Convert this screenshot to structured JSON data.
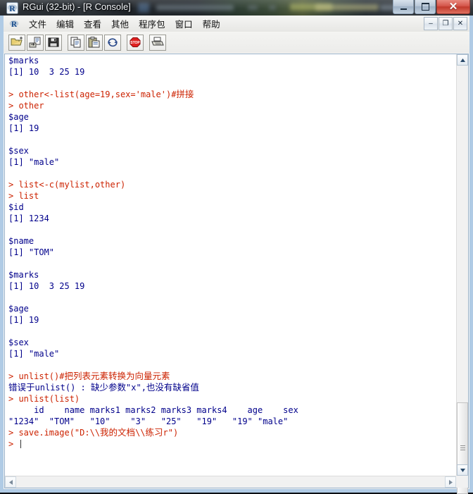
{
  "window": {
    "title": "RGui (32-bit) - [R Console]",
    "icon": "r-logo-icon",
    "caption_buttons": [
      {
        "name": "minimize-button",
        "label": "–"
      },
      {
        "name": "maximize-button",
        "label": "□"
      },
      {
        "name": "close-button",
        "label": "✕"
      }
    ]
  },
  "menubar": {
    "icon": "r-logo-icon",
    "items": [
      {
        "label": "文件"
      },
      {
        "label": "编辑"
      },
      {
        "label": "查看"
      },
      {
        "label": "其他"
      },
      {
        "label": "程序包"
      },
      {
        "label": "窗口"
      },
      {
        "label": "帮助"
      }
    ],
    "mdi_buttons": [
      {
        "name": "mdi-minimize-button",
        "label": "–"
      },
      {
        "name": "mdi-restore-button",
        "label": "❐"
      },
      {
        "name": "mdi-close-button",
        "label": "✕"
      }
    ]
  },
  "toolbar": {
    "buttons": [
      {
        "name": "open-script-icon",
        "tip": "Open script"
      },
      {
        "name": "load-workspace-icon",
        "tip": "Load workspace"
      },
      {
        "name": "save-workspace-icon",
        "tip": "Save workspace"
      },
      {
        "name": "copy-icon",
        "tip": "Copy"
      },
      {
        "name": "paste-icon",
        "tip": "Paste"
      },
      {
        "name": "copy-paste-icon",
        "tip": "Copy and paste"
      },
      {
        "name": "stop-icon",
        "tip": "Stop current computation"
      },
      {
        "name": "print-icon",
        "tip": "Print"
      }
    ]
  },
  "console": {
    "lines": [
      {
        "type": "out",
        "text": "$marks"
      },
      {
        "type": "out",
        "text": "[1] 10  3 25 19"
      },
      {
        "type": "blank",
        "text": ""
      },
      {
        "type": "cmd",
        "text": "> other<-list(age=19,sex='male')#拼接"
      },
      {
        "type": "cmd",
        "text": "> other"
      },
      {
        "type": "out",
        "text": "$age"
      },
      {
        "type": "out",
        "text": "[1] 19"
      },
      {
        "type": "blank",
        "text": ""
      },
      {
        "type": "out",
        "text": "$sex"
      },
      {
        "type": "out",
        "text": "[1] \"male\""
      },
      {
        "type": "blank",
        "text": ""
      },
      {
        "type": "cmd",
        "text": "> list<-c(mylist,other)"
      },
      {
        "type": "cmd",
        "text": "> list"
      },
      {
        "type": "out",
        "text": "$id"
      },
      {
        "type": "out",
        "text": "[1] 1234"
      },
      {
        "type": "blank",
        "text": ""
      },
      {
        "type": "out",
        "text": "$name"
      },
      {
        "type": "out",
        "text": "[1] \"TOM\""
      },
      {
        "type": "blank",
        "text": ""
      },
      {
        "type": "out",
        "text": "$marks"
      },
      {
        "type": "out",
        "text": "[1] 10  3 25 19"
      },
      {
        "type": "blank",
        "text": ""
      },
      {
        "type": "out",
        "text": "$age"
      },
      {
        "type": "out",
        "text": "[1] 19"
      },
      {
        "type": "blank",
        "text": ""
      },
      {
        "type": "out",
        "text": "$sex"
      },
      {
        "type": "out",
        "text": "[1] \"male\""
      },
      {
        "type": "blank",
        "text": ""
      },
      {
        "type": "cmd",
        "text": "> unlist()#把列表元素转换为向量元素"
      },
      {
        "type": "err",
        "text": "错误于unlist() : 缺少参数\"x\",也没有缺省值"
      },
      {
        "type": "cmd",
        "text": "> unlist(list)"
      },
      {
        "type": "out",
        "text": "     id    name marks1 marks2 marks3 marks4    age    sex"
      },
      {
        "type": "out",
        "text": "\"1234\"  \"TOM\"   \"10\"    \"3\"   \"25\"   \"19\"   \"19\" \"male\""
      },
      {
        "type": "cmd",
        "text": "> save.image(\"D:\\\\我的文档\\\\练习r\")"
      },
      {
        "type": "cmd-cursor",
        "text": "> "
      }
    ],
    "colors": {
      "command": "#cc2200",
      "output": "#00008b",
      "background": "#ffffff"
    }
  },
  "scrollbars": {
    "vertical": {
      "up_arrow": "▲",
      "down_arrow": "▼"
    },
    "horizontal": {
      "left_arrow": "◀",
      "right_arrow": "▶"
    }
  }
}
